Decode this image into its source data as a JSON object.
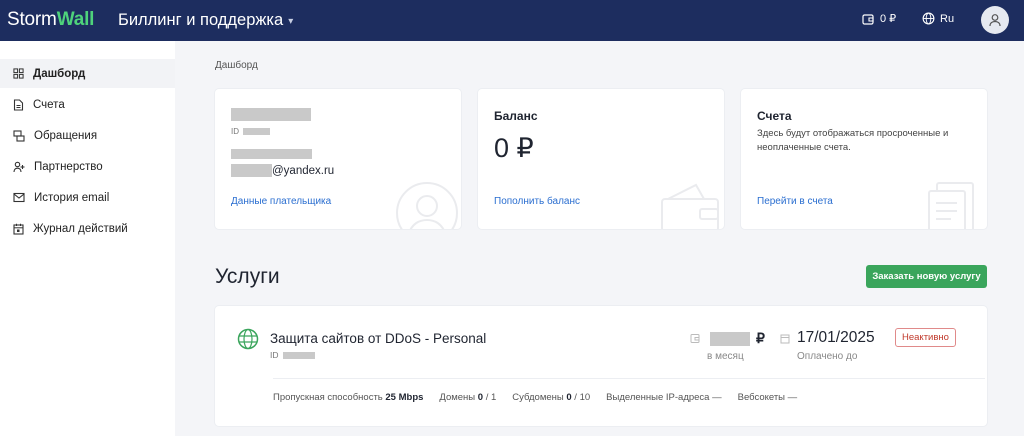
{
  "header": {
    "logo_part1": "Storm",
    "logo_part2": "Wall",
    "app_title": "Биллинг и поддержка",
    "balance": "0 ₽",
    "language": "Ru"
  },
  "sidebar": {
    "items": [
      {
        "label": "Дашборд",
        "icon": "dashboard-icon",
        "active": true
      },
      {
        "label": "Счета",
        "icon": "document-icon"
      },
      {
        "label": "Обращения",
        "icon": "chat-icon"
      },
      {
        "label": "Партнерство",
        "icon": "partners-icon"
      },
      {
        "label": "История email",
        "icon": "mail-icon"
      },
      {
        "label": "Журнал действий",
        "icon": "calendar-icon"
      }
    ]
  },
  "breadcrumb": "Дашборд",
  "payer_card": {
    "id_label": "ID",
    "email_suffix": "@yandex.ru",
    "link": "Данные плательщика"
  },
  "balance_card": {
    "title": "Баланс",
    "amount": "0 ₽",
    "link": "Пополнить баланс"
  },
  "invoices_card": {
    "title": "Счета",
    "description": "Здесь будут отображаться просроченные и неоплаченные счета.",
    "link": "Перейти в счета"
  },
  "services": {
    "title": "Услуги",
    "order_button": "Заказать новую услугу",
    "items": [
      {
        "name": "Защита сайтов от DDoS - Personal",
        "id_label": "ID",
        "currency": "₽",
        "price_caption": "в месяц",
        "paid_until": "17/01/2025",
        "paid_caption": "Оплачено до",
        "status": "Неактивно",
        "stats": [
          {
            "label": "Пропускная способность",
            "value": "25 Mbps",
            "suffix": ""
          },
          {
            "label": "Домены",
            "value": "0",
            "suffix": "/ 1"
          },
          {
            "label": "Субдомены",
            "value": "0",
            "suffix": "/ 10"
          },
          {
            "label": "Выделенные IP-адреса",
            "value": "",
            "suffix": "—"
          },
          {
            "label": "Вебсокеты",
            "value": "",
            "suffix": "—"
          }
        ]
      }
    ]
  },
  "colors": {
    "header_bg": "#1d2d5f",
    "brand_green": "#4ed27b",
    "link_blue": "#2a6ed0",
    "button_green": "#3aa55c",
    "inactive_red": "#c0392b"
  }
}
